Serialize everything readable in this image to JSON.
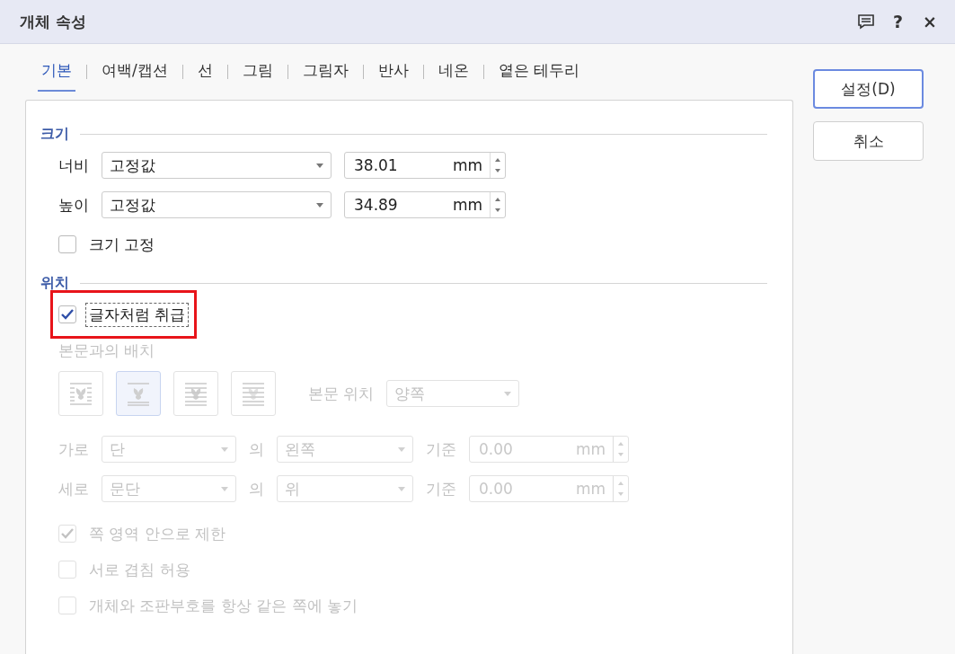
{
  "window": {
    "title": "개체 속성",
    "controls": [
      {
        "kind": "comment"
      },
      {
        "kind": "help",
        "label": "?"
      },
      {
        "kind": "close",
        "label": "×"
      }
    ]
  },
  "tabs": [
    {
      "label": "기본",
      "selected": true
    },
    {
      "label": "여백/캡션",
      "selected": false
    },
    {
      "label": "선",
      "selected": false
    },
    {
      "label": "그림",
      "selected": false
    },
    {
      "label": "그림자",
      "selected": false
    },
    {
      "label": "반사",
      "selected": false
    },
    {
      "label": "네온",
      "selected": false
    },
    {
      "label": "옅은 테두리",
      "selected": false
    }
  ],
  "size": {
    "heading": "크기",
    "rows": [
      {
        "label": "너비",
        "mode": "고정값",
        "value": "38.01",
        "unit": "mm"
      },
      {
        "label": "높이",
        "mode": "고정값",
        "value": "34.89",
        "unit": "mm"
      }
    ],
    "lock": {
      "label": "크기 고정",
      "checked": false
    }
  },
  "position": {
    "heading": "위치",
    "treat_as_char": {
      "label": "글자처럼 취급",
      "checked": true,
      "focused": true,
      "highlighted": true
    },
    "disabled": true,
    "wrap_label": "본문과의 배치",
    "wrap_options": [
      {
        "kind": "square",
        "selected": false
      },
      {
        "kind": "top-bottom",
        "selected": true
      },
      {
        "kind": "behind",
        "selected": false
      },
      {
        "kind": "front",
        "selected": false
      }
    ],
    "text_side": {
      "label": "본문 위치",
      "value": "양쪽"
    },
    "rows": [
      {
        "label": "가로",
        "anchor": "단",
        "of": "의",
        "side": "왼쪽",
        "ref": "기준",
        "value": "0.00",
        "unit": "mm"
      },
      {
        "label": "세로",
        "anchor": "문단",
        "of": "의",
        "side": "위",
        "ref": "기준",
        "value": "0.00",
        "unit": "mm"
      }
    ],
    "options": [
      {
        "label": "쪽 영역 안으로 제한",
        "checked": true
      },
      {
        "label": "서로 겹침 허용",
        "checked": false
      },
      {
        "label": "개체와 조판부호를 항상 같은 쪽에 놓기",
        "checked": false
      }
    ]
  },
  "buttons": [
    {
      "label": "설정(D)",
      "default": true
    },
    {
      "label": "취소",
      "default": false
    }
  ]
}
